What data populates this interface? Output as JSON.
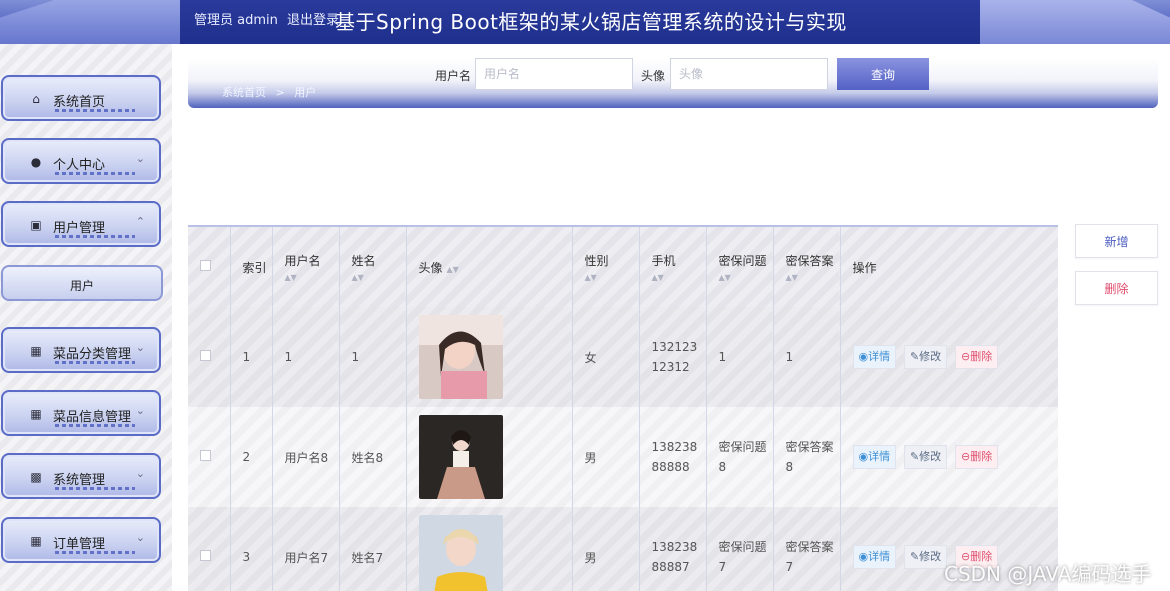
{
  "header": {
    "admin_text": "管理员 admin",
    "logout_label": "退出登录",
    "title": "基于Spring Boot框架的某火锅店管理系统的设计与实现"
  },
  "sidebar": {
    "items": [
      {
        "label": "系统首页",
        "icon": "home-icon"
      },
      {
        "label": "个人中心",
        "icon": "user-icon"
      },
      {
        "label": "用户管理",
        "icon": "users-icon"
      },
      {
        "label": "菜品分类管理",
        "icon": "grid-icon"
      },
      {
        "label": "菜品信息管理",
        "icon": "grid-icon"
      },
      {
        "label": "系统管理",
        "icon": "clipboard-icon"
      },
      {
        "label": "订单管理",
        "icon": "grid-icon"
      }
    ],
    "sub_item": "用户"
  },
  "breadcrumb": {
    "home": "系统首页",
    "sep": ">",
    "current": "用户"
  },
  "search": {
    "username_label": "用户名",
    "username_placeholder": "用户名",
    "avatar_label": "头像",
    "avatar_placeholder": "头像",
    "button": "查询"
  },
  "actions": {
    "add": "新增",
    "delete": "删除"
  },
  "table": {
    "headers": {
      "index": "索引",
      "username": "用户名",
      "name": "姓名",
      "avatar": "头像",
      "gender": "性别",
      "phone": "手机",
      "question": "密保问题",
      "answer": "密保答案",
      "ops": "操作"
    },
    "rows": [
      {
        "index": "1",
        "username": "1",
        "name": "1",
        "gender": "女",
        "phone": "13212312312",
        "question": "1",
        "answer": "1"
      },
      {
        "index": "2",
        "username": "用户名8",
        "name": "姓名8",
        "gender": "男",
        "phone": "13823888888",
        "question": "密保问题8",
        "answer": "密保答案8"
      },
      {
        "index": "3",
        "username": "用户名7",
        "name": "姓名7",
        "gender": "男",
        "phone": "13823888887",
        "question": "密保问题7",
        "answer": "密保答案7"
      }
    ],
    "op_labels": {
      "detail": "详情",
      "edit": "修改",
      "delete": "删除"
    }
  },
  "watermark": "CSDN @JAVA编码选手",
  "colors": {
    "accent": "#3f51b0",
    "delete": "#e0506e",
    "detail": "#3d8fd6"
  }
}
